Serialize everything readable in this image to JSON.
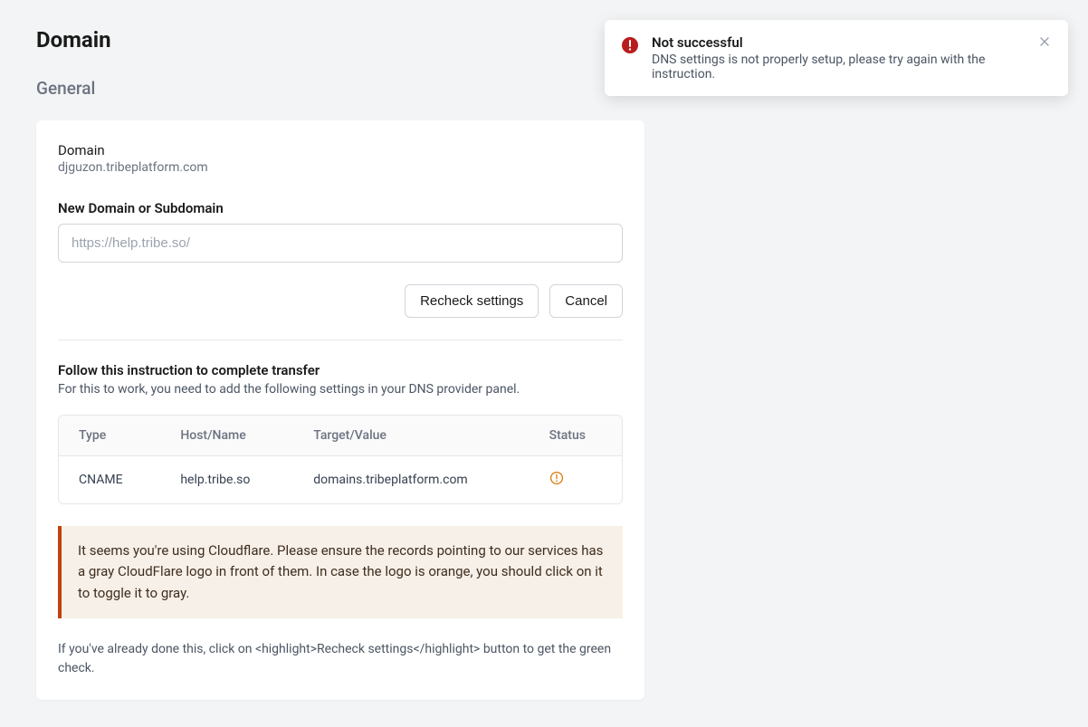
{
  "page": {
    "title": "Domain",
    "section": "General"
  },
  "domain": {
    "label": "Domain",
    "current": "djguzon.tribeplatform.com"
  },
  "form": {
    "new_domain_label": "New Domain or Subdomain",
    "new_domain_placeholder": "https://help.tribe.so/",
    "recheck_label": "Recheck settings",
    "cancel_label": "Cancel"
  },
  "instruction": {
    "title": "Follow this instruction to complete transfer",
    "description": "For this to work, you need to add the following settings in your DNS provider panel."
  },
  "dns": {
    "headers": {
      "type": "Type",
      "host": "Host/Name",
      "target": "Target/Value",
      "status": "Status"
    },
    "rows": [
      {
        "type": "CNAME",
        "host": "help.tribe.so",
        "target": "domains.tribeplatform.com",
        "status": "warning"
      }
    ]
  },
  "warning": {
    "text": "It seems you're using Cloudflare. Please ensure the records pointing to our services has a gray CloudFlare logo in front of them. In case the logo is orange, you should click on it to toggle it to gray."
  },
  "footer": {
    "note": "If you've already done this, click on <highlight>Recheck settings</highlight> button to get the green check."
  },
  "toast": {
    "title": "Not successful",
    "message": "DNS settings is not properly setup, please try again with the instruction."
  },
  "colors": {
    "error": "#b91c1c",
    "warning": "#d97706"
  }
}
